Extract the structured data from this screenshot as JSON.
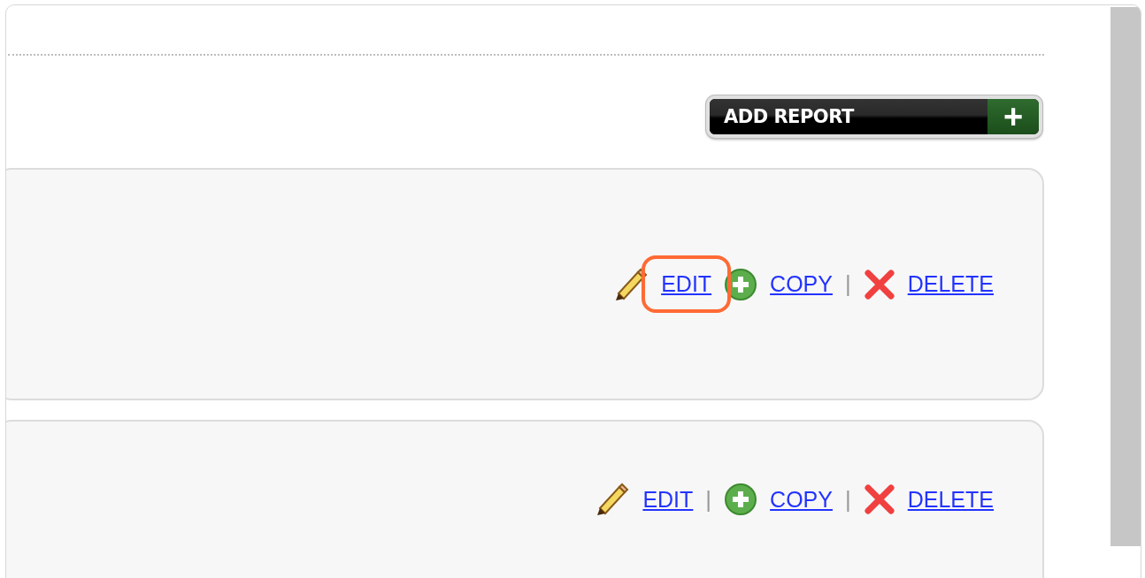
{
  "toolbar": {
    "add_button": {
      "label": "ADD REPORT",
      "icon_symbol": "+"
    }
  },
  "reports": [
    {
      "actions": [
        {
          "kind": "edit",
          "label": "EDIT",
          "separator_before": false,
          "highlighted": true
        },
        {
          "kind": "copy",
          "label": "COPY",
          "separator_before": false,
          "highlighted": false
        },
        {
          "kind": "delete",
          "label": "DELETE",
          "separator_before": true,
          "highlighted": false
        }
      ]
    },
    {
      "actions": [
        {
          "kind": "edit",
          "label": "EDIT",
          "separator_before": false,
          "highlighted": false
        },
        {
          "kind": "copy",
          "label": "COPY",
          "separator_before": true,
          "highlighted": false
        },
        {
          "kind": "delete",
          "label": "DELETE",
          "separator_before": true,
          "highlighted": false
        }
      ]
    }
  ],
  "separator_text": "|"
}
